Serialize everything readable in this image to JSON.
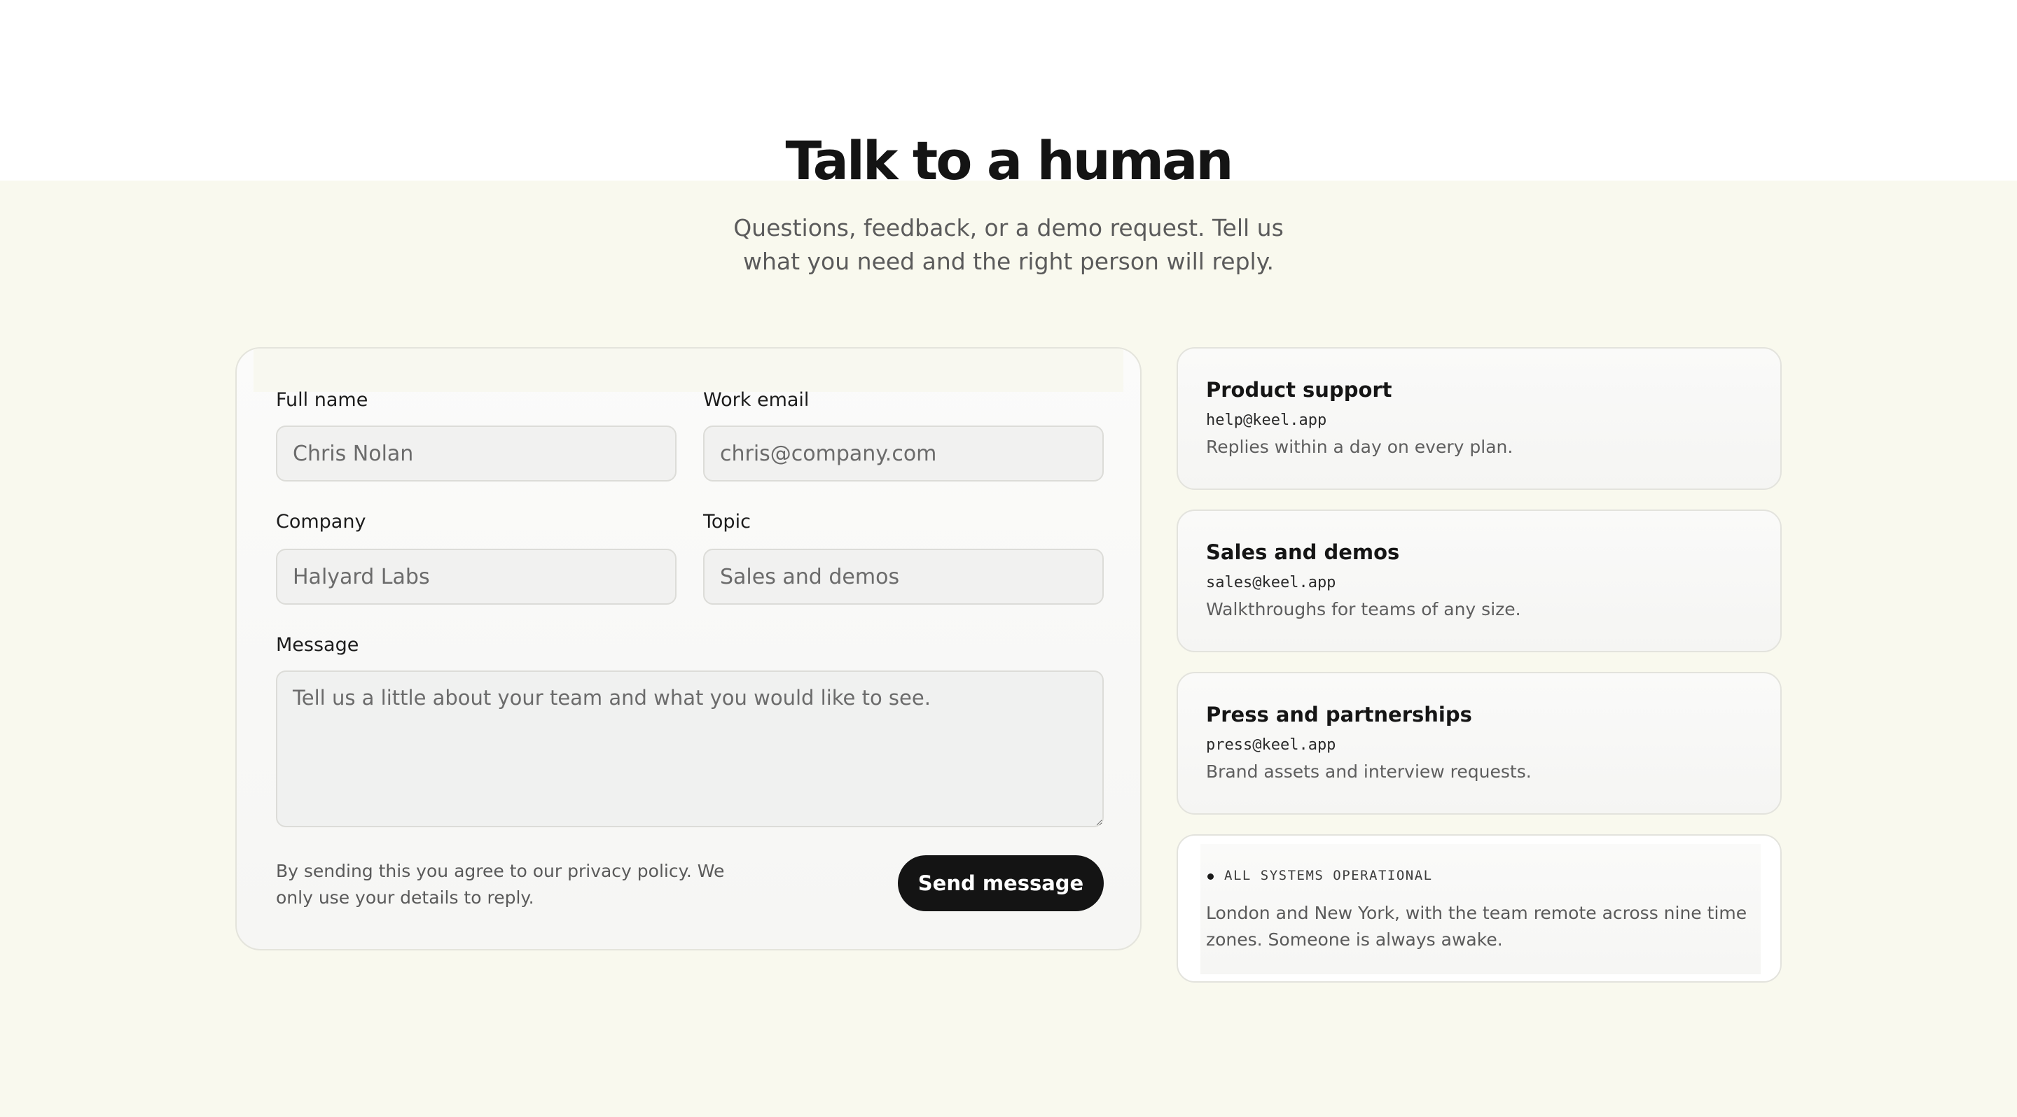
{
  "hero": {
    "title": "Talk to a human",
    "subtitle": "Questions, feedback, or a demo request. Tell us what you need and the right person will reply."
  },
  "form": {
    "full_name": {
      "label": "Full name",
      "placeholder": "Chris Nolan"
    },
    "work_email": {
      "label": "Work email",
      "placeholder": "chris@company.com"
    },
    "company": {
      "label": "Company",
      "placeholder": "Halyard Labs"
    },
    "topic": {
      "label": "Topic",
      "placeholder": "Sales and demos"
    },
    "message": {
      "label": "Message",
      "placeholder": "Tell us a little about your team and what you would like to see."
    },
    "legal": "By sending this you agree to our privacy policy. We only use your details to reply.",
    "submit_label": "Send message"
  },
  "contacts": [
    {
      "title": "Product support",
      "email": "help@keel.app",
      "description": "Replies within a day on every plan."
    },
    {
      "title": "Sales and demos",
      "email": "sales@keel.app",
      "description": "Walkthroughs for teams of any size."
    },
    {
      "title": "Press and partnerships",
      "email": "press@keel.app",
      "description": "Brand assets and interview requests."
    }
  ],
  "status": {
    "label": "ALL SYSTEMS OPERATIONAL",
    "description": "London and New York, with the team remote across nine time zones. Someone is always awake."
  },
  "colors": {
    "page_background": "#f9f9ee",
    "button_background": "#141414",
    "button_text": "#ffffff"
  }
}
